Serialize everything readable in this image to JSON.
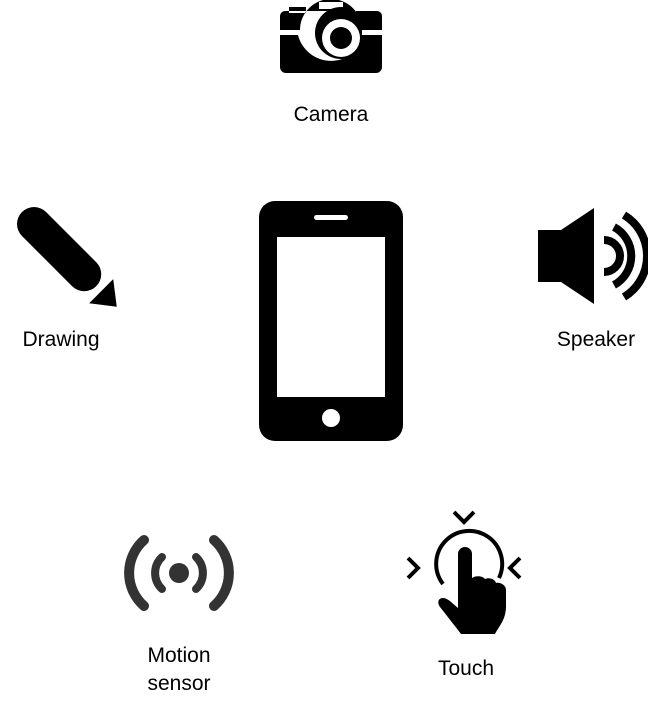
{
  "colors": {
    "foreground": "#000000",
    "motion_sensor": "#333333",
    "background": "#ffffff"
  },
  "center": {
    "icon": "smartphone-icon"
  },
  "features": {
    "camera": {
      "icon": "camera-icon",
      "label": "Camera"
    },
    "drawing": {
      "icon": "pencil-icon",
      "label": "Drawing"
    },
    "speaker": {
      "icon": "speaker-icon",
      "label": "Speaker"
    },
    "motion_sensor": {
      "icon": "motion-sensor-icon",
      "label_line1": "Motion",
      "label_line2": "sensor"
    },
    "touch": {
      "icon": "touch-icon",
      "label": "Touch"
    }
  }
}
